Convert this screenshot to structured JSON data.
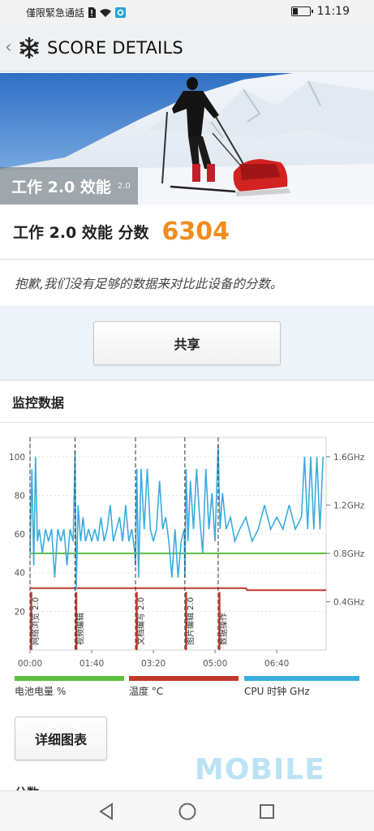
{
  "status_bar": {
    "carrier_text": "僅限緊急通話",
    "time": "11:19"
  },
  "app_bar": {
    "title": "SCORE DETAILS"
  },
  "hero": {
    "label": "工作 2.0 效能",
    "version": "2.0"
  },
  "score": {
    "label": "工作 2.0 效能 分数",
    "value": "6304"
  },
  "message": "抱歉,我们没有足够的数据来对比此设备的分数。",
  "share_button_label": "共享",
  "monitor": {
    "title": "监控数据",
    "detail_button_label": "详细图表",
    "partial_heading": "分数"
  },
  "chart_data": {
    "type": "line",
    "x_tick_labels": [
      "00:00",
      "01:40",
      "03:20",
      "05:00",
      "06:40"
    ],
    "x_range_seconds": [
      0,
      480
    ],
    "left_axis": {
      "ticks": [
        20,
        40,
        60,
        80,
        100
      ],
      "range": [
        0,
        110
      ]
    },
    "right_axis": {
      "ticks": [
        "0.4GHz",
        "0.8GHz",
        "1.2GHz",
        "1.6GHz"
      ],
      "range_ghz": [
        0,
        1.76
      ]
    },
    "phases": [
      {
        "label": "网络浏览 2.0",
        "start": 0
      },
      {
        "label": "视频编辑",
        "start": 73
      },
      {
        "label": "文档编写 2.0",
        "start": 171
      },
      {
        "label": "图片编辑 2.0",
        "start": 251
      },
      {
        "label": "数据操作",
        "start": 305
      }
    ],
    "series": [
      {
        "name": "电池电量 %",
        "color": "#5bbf3e",
        "x": [
          0,
          480
        ],
        "y": [
          50,
          50
        ]
      },
      {
        "name": "温度 °C",
        "color": "#c0392b",
        "x": [
          0,
          350,
          352,
          480
        ],
        "y": [
          32,
          32,
          31,
          31
        ]
      },
      {
        "name": "CPU 时钟 GHz",
        "color": "#3aace0",
        "x": [
          0,
          3,
          6,
          9,
          12,
          15,
          20,
          25,
          30,
          35,
          40,
          45,
          50,
          55,
          60,
          65,
          70,
          73,
          75,
          78,
          82,
          86,
          90,
          95,
          100,
          105,
          110,
          115,
          120,
          125,
          130,
          135,
          140,
          145,
          150,
          155,
          160,
          165,
          170,
          171,
          173,
          176,
          180,
          185,
          190,
          195,
          200,
          205,
          210,
          215,
          220,
          225,
          230,
          235,
          240,
          245,
          250,
          251,
          253,
          256,
          260,
          265,
          270,
          275,
          280,
          285,
          290,
          295,
          300,
          305,
          308,
          312,
          318,
          325,
          332,
          340,
          350,
          360,
          370,
          380,
          390,
          400,
          410,
          420,
          430,
          440,
          445,
          450,
          455,
          460,
          465,
          470,
          475
        ],
        "y": [
          0.8,
          1.5,
          0.7,
          1.6,
          0.9,
          1.0,
          0.8,
          1.0,
          0.9,
          1.0,
          0.6,
          1.0,
          0.9,
          1.0,
          0.7,
          1.0,
          0.9,
          1.65,
          0.5,
          1.2,
          0.9,
          1.1,
          0.9,
          1.0,
          0.9,
          1.0,
          0.9,
          1.1,
          0.9,
          1.0,
          1.2,
          0.9,
          1.0,
          1.1,
          0.9,
          1.2,
          0.9,
          1.0,
          0.8,
          0.7,
          1.5,
          0.6,
          1.5,
          1.0,
          1.5,
          1.0,
          0.9,
          1.0,
          1.4,
          1.0,
          1.1,
          0.9,
          0.6,
          1.0,
          0.6,
          0.9,
          1.0,
          0.6,
          1.5,
          0.9,
          1.4,
          1.0,
          1.5,
          1.1,
          0.8,
          1.5,
          1.0,
          1.3,
          0.9,
          1.7,
          1.0,
          1.3,
          1.0,
          1.1,
          0.9,
          1.0,
          1.1,
          0.9,
          1.0,
          1.2,
          1.0,
          1.1,
          1.0,
          1.2,
          1.0,
          1.1,
          1.6,
          1.0,
          1.6,
          1.0,
          1.6,
          1.0,
          1.6
        ]
      }
    ]
  },
  "watermark": "MOBILE",
  "colors": {
    "score": "#f08c1e",
    "battery": "#5bbf3e",
    "temperature": "#c0392b",
    "cpu": "#3aace0"
  }
}
